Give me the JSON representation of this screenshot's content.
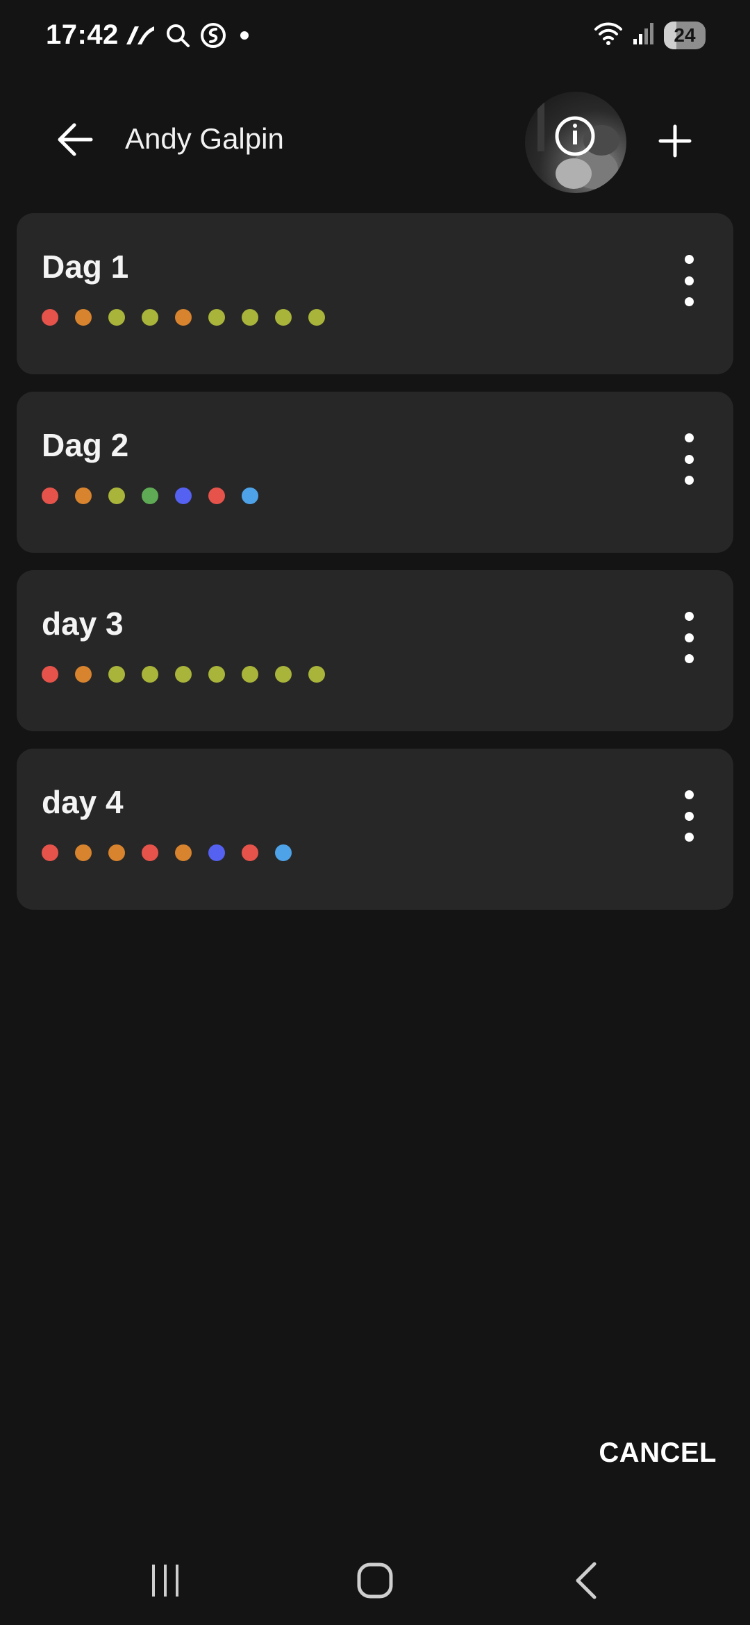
{
  "status_bar": {
    "time": "17:42",
    "battery": "24",
    "left_icons": [
      "tidal-icon",
      "search-status-icon",
      "shazam-icon",
      "notification-dot-icon"
    ],
    "right_icons": [
      "wifi-icon",
      "signal-icon",
      "battery-icon"
    ]
  },
  "header": {
    "title": "Andy Galpin",
    "back_icon": "arrow-left-icon",
    "add_icon": "plus-icon",
    "avatar": "kettlebell-photo"
  },
  "colors": {
    "red": "#E5534B",
    "orange": "#D8832E",
    "olive": "#A9B43A",
    "green": "#5FAA55",
    "indigo": "#5561F0",
    "blue": "#4EA3E8"
  },
  "workouts": [
    {
      "title": "Dag 1",
      "dots": [
        "#E5534B",
        "#D8832E",
        "#A9B43A",
        "#A9B43A",
        "#D8832E",
        "#A9B43A",
        "#A9B43A",
        "#A9B43A",
        "#A9B43A"
      ]
    },
    {
      "title": "Dag 2",
      "dots": [
        "#E5534B",
        "#D8832E",
        "#A9B43A",
        "#5FAA55",
        "#5561F0",
        "#E5534B",
        "#4EA3E8"
      ]
    },
    {
      "title": "day 3",
      "dots": [
        "#E5534B",
        "#D8832E",
        "#A9B43A",
        "#A9B43A",
        "#A9B43A",
        "#A9B43A",
        "#A9B43A",
        "#A9B43A",
        "#A9B43A"
      ]
    },
    {
      "title": "day 4",
      "dots": [
        "#E5534B",
        "#D8832E",
        "#D8832E",
        "#E5534B",
        "#D8832E",
        "#5561F0",
        "#E5534B",
        "#4EA3E8"
      ]
    }
  ],
  "actions": {
    "cancel_label": "CANCEL"
  },
  "nav_bar": {
    "icons": [
      "recents-icon",
      "home-icon",
      "back-icon"
    ]
  }
}
